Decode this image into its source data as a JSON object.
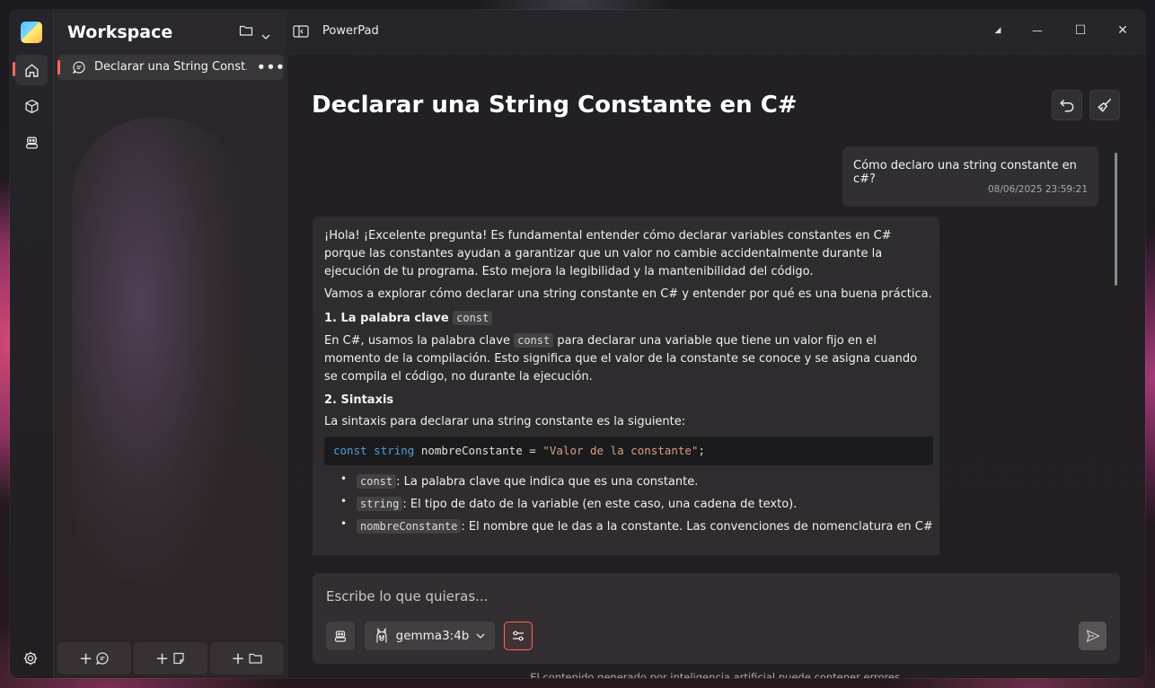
{
  "app": {
    "workspace_title": "Workspace",
    "window_title": "PowerPad"
  },
  "sidebar": {
    "chats": [
      {
        "label": "Declarar una String Const...",
        "more": "•••"
      }
    ],
    "bottom_buttons": [
      {
        "label": "+",
        "icon": "new-chat-icon"
      },
      {
        "label": "+",
        "icon": "new-note-icon"
      },
      {
        "label": "+",
        "icon": "new-folder-icon"
      }
    ]
  },
  "window_controls": {
    "compact": "◢",
    "minimize": "—",
    "maximize": "☐",
    "close": "✕"
  },
  "chat": {
    "title": "Declarar una String Constante en C#",
    "user_message": {
      "text": "Cómo declaro una string constante en c#?",
      "timestamp": "08/06/2025 23:59:21"
    },
    "bot_message": {
      "p1": "¡Hola! ¡Excelente pregunta! Es fundamental entender cómo declarar variables constantes en C# porque las constantes ayudan a garantizar que un valor no cambie accidentalmente durante la ejecución de tu programa. Esto mejora la legibilidad y la mantenibilidad del código.",
      "p2": "Vamos a explorar cómo declarar una string constante en C# y entender por qué es una buena práctica.",
      "h1_text": "1. La palabra clave",
      "h1_code": "const",
      "p3_before": "En C#, usamos la palabra clave",
      "p3_code": "const",
      "p3_after": "para declarar una variable que tiene un valor fijo en el momento de la compilación. Esto significa que el valor de la constante se conoce y se asigna cuando se compila el código, no durante la ejecución.",
      "h2_text": "2. Sintaxis",
      "p4": "La sintaxis para declarar una string constante es la siguiente:",
      "code": {
        "kw1": "const",
        "kw2": "string",
        "ident": "nombreConstante",
        "op": "=",
        "str": "\"Valor de la constante\"",
        "end": ";"
      },
      "bullets": [
        {
          "code": "const",
          "text": ": La palabra clave que indica que es una constante."
        },
        {
          "code": "string",
          "text": ": El tipo de dato de la variable (en este caso, una cadena de texto)."
        },
        {
          "code": "nombreConstante",
          "text": ": El nombre que le das a la constante. Las convenciones de nomenclatura en C#"
        }
      ]
    }
  },
  "composer": {
    "placeholder": "Escribe lo que quieras...",
    "model": "gemma3:4b"
  },
  "footer": {
    "disclaimer": "El contenido generado por inteligencia artificial puede contener errores."
  },
  "colors": {
    "accent": "#f26b5c",
    "keyword": "#569cd6",
    "string": "#d69d85"
  }
}
